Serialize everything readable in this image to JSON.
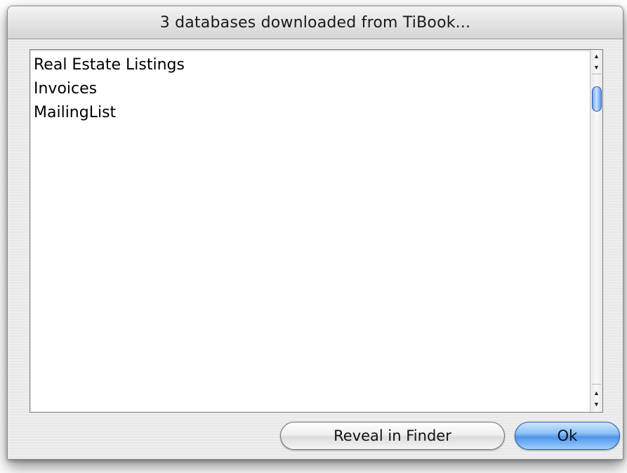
{
  "window": {
    "title": "3 databases downloaded from TiBook..."
  },
  "list": {
    "items": [
      {
        "label": "Real Estate Listings"
      },
      {
        "label": "Invoices"
      },
      {
        "label": "MailingList"
      }
    ]
  },
  "scrollbar": {
    "up_arrow": "▲",
    "down_arrow": "▼"
  },
  "buttons": {
    "reveal_label": "Reveal in Finder",
    "ok_label": "Ok"
  },
  "colors": {
    "default_button": "#4f95e8",
    "scroll_thumb": "#6aa4ee"
  }
}
